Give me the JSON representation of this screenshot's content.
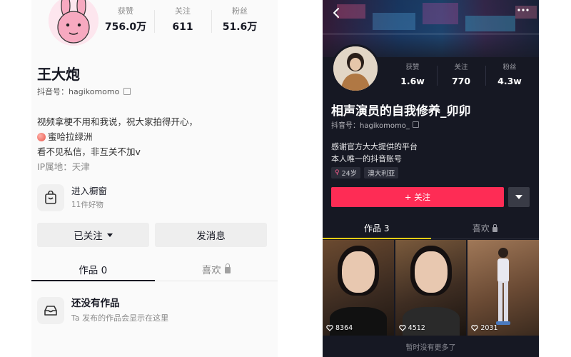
{
  "left": {
    "stats": [
      {
        "label": "获赞",
        "value": "756.0万"
      },
      {
        "label": "关注",
        "value": "611"
      },
      {
        "label": "粉丝",
        "value": "51.6万"
      }
    ],
    "name": "王大炮",
    "handle": "抖音号：hagikomomo",
    "bio": {
      "line1": "视频拿梗不用和我说，祝大家拍得开心，",
      "line2": "蜜哈拉绿洲",
      "line3": "看不见私信，非互关不加v",
      "ip": "IP属地：天津"
    },
    "shop": {
      "title": "进入橱窗",
      "subtitle": "11件好物"
    },
    "buttons": {
      "following": "已关注",
      "message": "发消息"
    },
    "tabs": [
      {
        "label": "作品 0"
      },
      {
        "label": "喜欢"
      }
    ],
    "empty": {
      "title": "还没有作品",
      "subtitle": "Ta 发布的作品会显示在这里"
    }
  },
  "right": {
    "stats": [
      {
        "label": "获赞",
        "value": "1.6w"
      },
      {
        "label": "关注",
        "value": "770"
      },
      {
        "label": "粉丝",
        "value": "4.3w"
      }
    ],
    "name": "相声演员的自我修养_卯卯",
    "handle": "抖音号：hagikomomo_",
    "bio": {
      "line1": "感谢官方大大提供的平台",
      "line2": "本人唯一的抖音账号"
    },
    "tags": [
      {
        "label": "24岁"
      },
      {
        "label": "澳大利亚"
      }
    ],
    "follow_label": "+ 关注",
    "tabs": [
      {
        "label": "作品 3"
      },
      {
        "label": "喜欢"
      }
    ],
    "videos": [
      {
        "likes": "8364"
      },
      {
        "likes": "4512"
      },
      {
        "likes": "2031"
      }
    ],
    "footer": "暂时没有更多了"
  },
  "colors": {
    "accent_red": "#fe2c55",
    "tab_underline_dark": "#face15",
    "dark_bg": "#161823",
    "light_bg": "#fafafa"
  },
  "icons": {
    "left_avatar": "pink-bunny-cartoon-avatar",
    "copy": "copy-icon",
    "shop": "shopping-bag-icon",
    "caret": "caret-down-icon",
    "lock": "lock-icon",
    "empty": "inbox-tray-icon",
    "back": "back-arrow-icon",
    "more": "more-dots-icon",
    "heart": "heart-outline-icon",
    "female": "female-symbol-icon"
  }
}
